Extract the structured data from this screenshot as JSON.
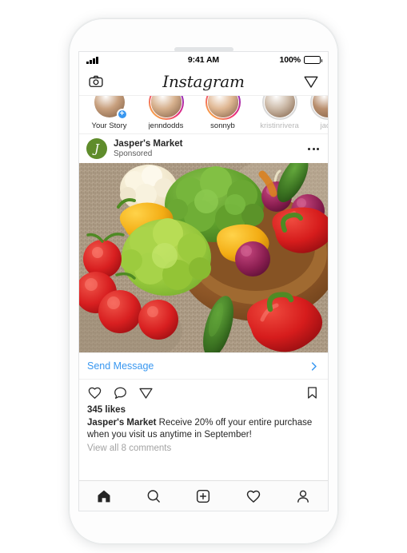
{
  "device": {
    "name": "white-iphone-mockup",
    "earpiece": "speaker-slot"
  },
  "statusbar": {
    "signal_icon": "signal-bars-icon",
    "time": "9:41 AM",
    "battery_percent": "100%",
    "battery_icon": "battery-full-icon"
  },
  "app_header": {
    "camera_icon": "camera-icon",
    "title": "Instagram",
    "direct_icon": "paper-plane-icon"
  },
  "stories": [
    {
      "label": "Your Story",
      "ring": "plain",
      "badge": "+",
      "muted": false,
      "skin": "#c8a07e"
    },
    {
      "label": "jenndodds",
      "ring": "unseen",
      "badge": "",
      "muted": false,
      "skin": "#d6b08d"
    },
    {
      "label": "sonnyb",
      "ring": "unseen",
      "badge": "",
      "muted": false,
      "skin": "#e0b894"
    },
    {
      "label": "kristinrivera",
      "ring": "seen",
      "badge": "",
      "muted": true,
      "skin": "#cdbba9"
    },
    {
      "label": "jacki",
      "ring": "seen",
      "badge": "",
      "muted": true,
      "skin": "#b98f6e"
    }
  ],
  "post": {
    "account_name": "Jasper's Market",
    "sponsored_label": "Sponsored",
    "avatar_mark": "J",
    "avatar_color": "#5f8c2b",
    "more_icon": "ellipsis-icon",
    "photo_alt": "assorted fresh vegetables in a wooden bowl on burlap",
    "cta_label": "Send Message",
    "cta_chevron_icon": "chevron-right-icon",
    "accent_color": "#3897f0",
    "actions": {
      "like_icon": "heart-icon",
      "comment_icon": "comment-bubble-icon",
      "share_icon": "paper-plane-icon",
      "save_icon": "bookmark-icon"
    },
    "likes": "345 likes",
    "caption_author": "Jasper's Market",
    "caption_text": " Receive 20% off your entire purchase when you visit us anytime in September!",
    "view_comments": "View all 8 comments"
  },
  "tabbar": [
    {
      "name": "home",
      "icon": "home-icon",
      "active": true
    },
    {
      "name": "search",
      "icon": "search-icon",
      "active": false
    },
    {
      "name": "create",
      "icon": "plus-square-icon",
      "active": false
    },
    {
      "name": "activity",
      "icon": "heart-icon",
      "active": false
    },
    {
      "name": "profile",
      "icon": "person-icon",
      "active": false
    }
  ]
}
